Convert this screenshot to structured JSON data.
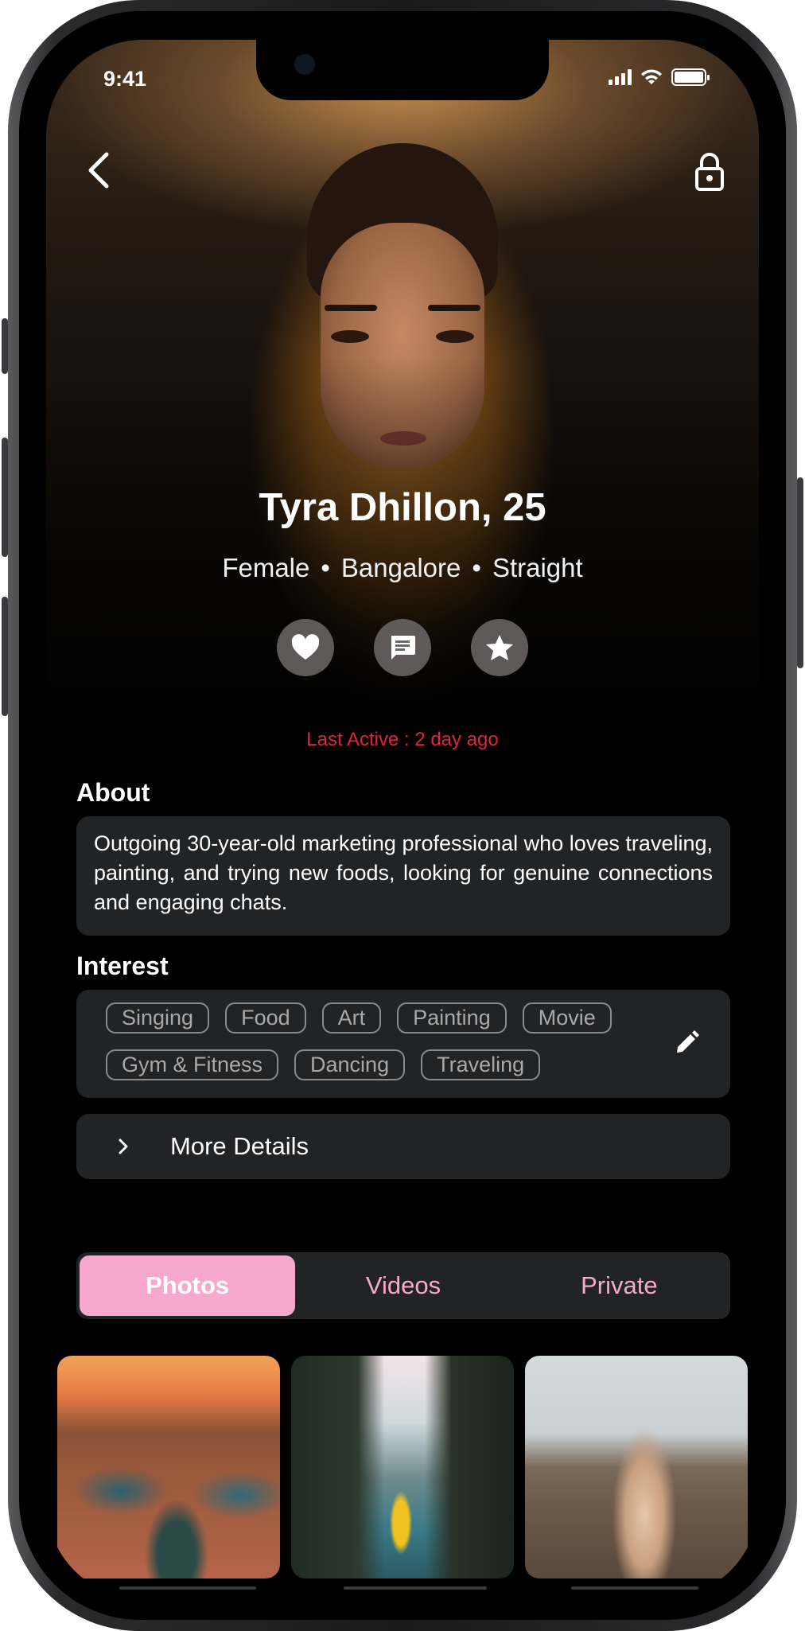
{
  "status_bar": {
    "time": "9:41"
  },
  "profile": {
    "name_age": "Tyra Dhillon, 25",
    "gender": "Female",
    "city": "Bangalore",
    "orientation": "Straight",
    "separator": "•",
    "last_active": "Last Active : 2 day ago"
  },
  "about": {
    "label": "About",
    "text": "Outgoing 30-year-old marketing professional who loves traveling, painting, and trying new foods, looking for genuine connections and engaging chats."
  },
  "interest": {
    "label": "Interest",
    "items": [
      "Singing",
      "Food",
      "Art",
      "Painting",
      "Movie",
      "Gym & Fitness",
      "Dancing",
      "Traveling"
    ]
  },
  "more_details": {
    "label": "More Details"
  },
  "media_tabs": {
    "tabs": [
      "Photos",
      "Videos",
      "Private"
    ],
    "active": "Photos"
  },
  "icons": {
    "back": "chevron-left-icon",
    "lock": "lock-icon",
    "like": "heart-icon",
    "message": "chat-icon",
    "favorite": "star-icon",
    "edit": "pencil-icon",
    "expand": "chevron-right-icon"
  },
  "colors": {
    "accent_pink": "#f7a8cd",
    "last_active_red": "#e2233a",
    "card_bg": "#222325"
  }
}
